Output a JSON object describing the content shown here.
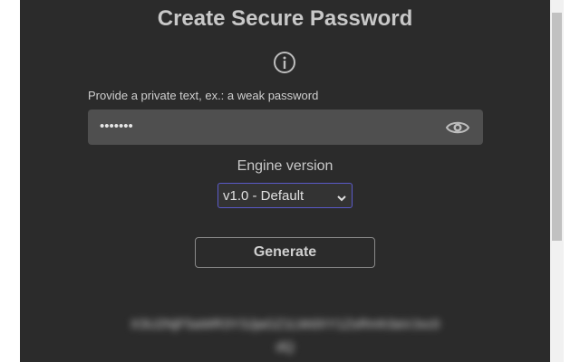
{
  "app": {
    "title": "Create Secure Password"
  },
  "icons": {
    "info": "info-icon",
    "visibility": "eye-icon",
    "dropdown": "chevron-down-icon"
  },
  "input": {
    "label": "Provide a private text, ex.: a weak password",
    "masked_value": "•••••••"
  },
  "engine": {
    "label": "Engine version",
    "selected": "v1.0 - Default"
  },
  "actions": {
    "generate_label": "Generate"
  },
  "result": {
    "text_blurred": "X3U2NjF5aWR3Y3JjaGZ1LWdXY1ZsRmh3aVJxc0dQ"
  },
  "colors": {
    "panel_bg": "#2b2b2b",
    "input_bg": "#4f4f4f",
    "select_border": "#5a5ac8",
    "text": "#c9c9c9"
  }
}
